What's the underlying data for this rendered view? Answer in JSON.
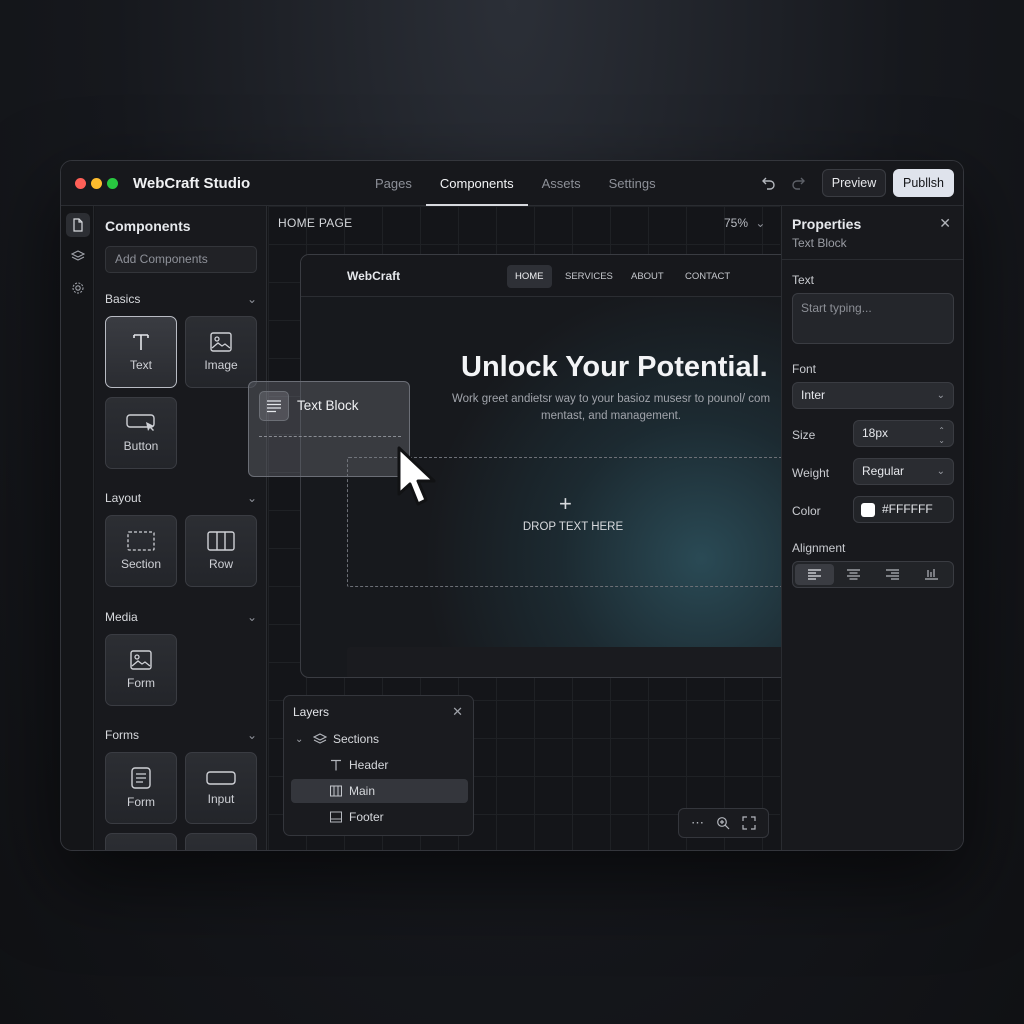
{
  "app": {
    "title": "WebCraft Studio"
  },
  "nav": {
    "tabs": [
      "Pages",
      "Components",
      "Assets",
      "Settings"
    ],
    "active_tab": "Components"
  },
  "toolbar": {
    "preview_label": "Preview",
    "publish_label": "Publlsh"
  },
  "components_panel": {
    "title": "Components",
    "search_placeholder": "Add Components",
    "groups": {
      "basics": {
        "label": "Basics",
        "items": [
          "Text",
          "Image",
          "Button"
        ]
      },
      "layout": {
        "label": "Layout",
        "items": [
          "Section",
          "Row"
        ]
      },
      "media": {
        "label": "Media",
        "items": [
          "Form"
        ]
      },
      "forms": {
        "label": "Forms",
        "items": [
          "Form",
          "Input"
        ]
      }
    }
  },
  "canvas": {
    "page_title": "HOME PAGE",
    "zoom": "75%",
    "preview": {
      "logo": "WebCraft",
      "nav_links": [
        "HOME",
        "SERVICES",
        "ABOUT",
        "CONTACT"
      ],
      "headline": "Unlock Your Potential.",
      "subline": "Work greet andietsr way to your basioz musesr to pounol/ com mentast, and management.",
      "drop_label": "DROP TEXT HERE"
    },
    "drag_ghost": {
      "label": "Text Block"
    }
  },
  "layers": {
    "title": "Layers",
    "items": [
      {
        "label": "Sections",
        "icon": "layers-icon"
      },
      {
        "label": "Header",
        "icon": "text-icon"
      },
      {
        "label": "Main",
        "icon": "columns-icon"
      },
      {
        "label": "Footer",
        "icon": "footer-icon"
      }
    ],
    "selected": "Main"
  },
  "properties": {
    "title": "Properties",
    "subtitle": "Text Block",
    "text_label": "Text",
    "text_placeholder": "Start typing...",
    "font_label": "Font",
    "font_value": "Inter",
    "size_label": "Size",
    "size_value": "18px",
    "weight_label": "Weight",
    "weight_value": "Regular",
    "color_label": "Color",
    "color_value": "#FFFFFF",
    "alignment_label": "Alignment",
    "alignment_selected": "left"
  },
  "colors": {
    "close_dot": "#ff5f57",
    "minimize_dot": "#febc2e",
    "maximize_dot": "#28c840",
    "accent": "#dfe3ec"
  }
}
